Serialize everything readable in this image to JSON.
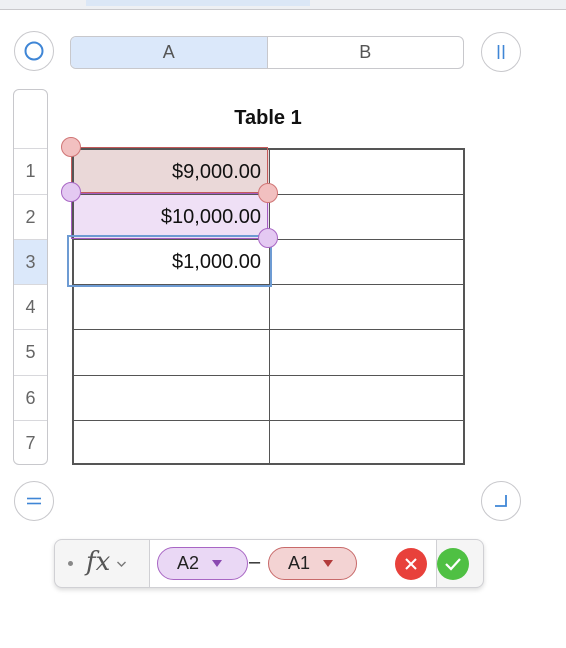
{
  "table": {
    "title": "Table 1",
    "columns": [
      "A",
      "B"
    ],
    "rows": [
      "1",
      "2",
      "3",
      "4",
      "5",
      "6",
      "7"
    ],
    "selected_column": "A",
    "selected_row": "3",
    "cells": {
      "A1": "$9,000.00",
      "A2": "$10,000.00",
      "A3": "$1,000.00"
    }
  },
  "controls": {
    "top_left_icon": "circle-select-icon",
    "top_right_icon": "column-pause-icon",
    "bottom_left_icon": "row-equals-icon",
    "bottom_right_icon": "corner-resize-icon"
  },
  "formula_editor": {
    "fx_label": "fx",
    "tokens": [
      {
        "ref": "A2",
        "color": "#a866c4"
      },
      {
        "ref": "A1",
        "color": "#c86a6a"
      }
    ],
    "operator": "–",
    "cancel_icon": "cancel-x-icon",
    "accept_icon": "accept-check-icon"
  },
  "colors": {
    "selection_blue": "#dbe8fa",
    "ref_red": "#c45a5a",
    "ref_purple": "#a55cc0",
    "cancel_red": "#e8413b",
    "accept_green": "#4fc043"
  }
}
